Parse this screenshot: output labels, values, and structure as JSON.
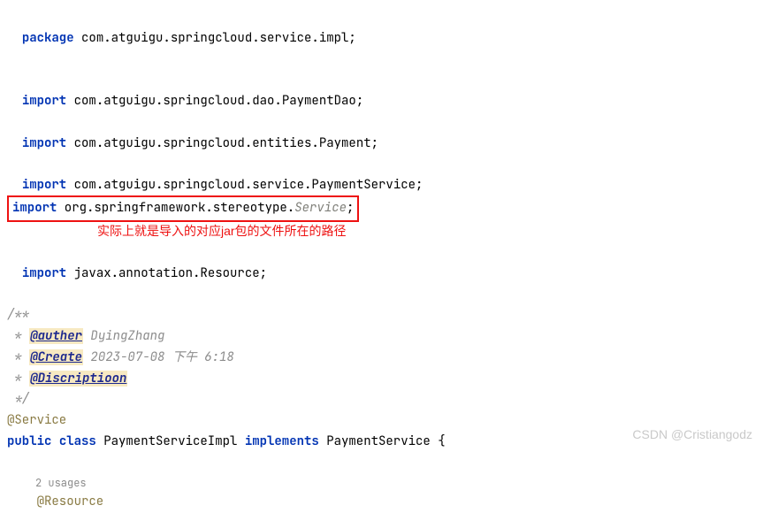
{
  "code": {
    "package_kw": "package",
    "package_name": " com.atguigu.springcloud.service.impl;",
    "import_kw": "import",
    "import1": " com.atguigu.springcloud.dao.PaymentDao;",
    "import2": " com.atguigu.springcloud.entities.Payment;",
    "import3": " com.atguigu.springcloud.service.PaymentService;",
    "import4_pkg": " org.springframework.stereotype.",
    "import4_cls": "Service",
    "import4_semi": ";",
    "annotation_text": "实际上就是导入的对应jar包的文件所在的路径",
    "import5": " javax.annotation.Resource;",
    "doc_open": "/**",
    "doc_star": " * ",
    "doc_auther_tag": "@auther",
    "doc_auther_val": " DyingZhang",
    "doc_create_tag": "@Create",
    "doc_create_val": " 2023-07-08 下午 6:18",
    "doc_discr_tag": "@Discriptioon",
    "doc_close": " */",
    "anno_service": "@Service",
    "public_kw": "public",
    "class_kw": "class",
    "class_name": " PaymentServiceImpl ",
    "implements_kw": "implements",
    "impl_name": " PaymentService {",
    "usages": "2 usages",
    "anno_resource": "@Resource"
  },
  "watermark": "CSDN @Cristiangodz"
}
